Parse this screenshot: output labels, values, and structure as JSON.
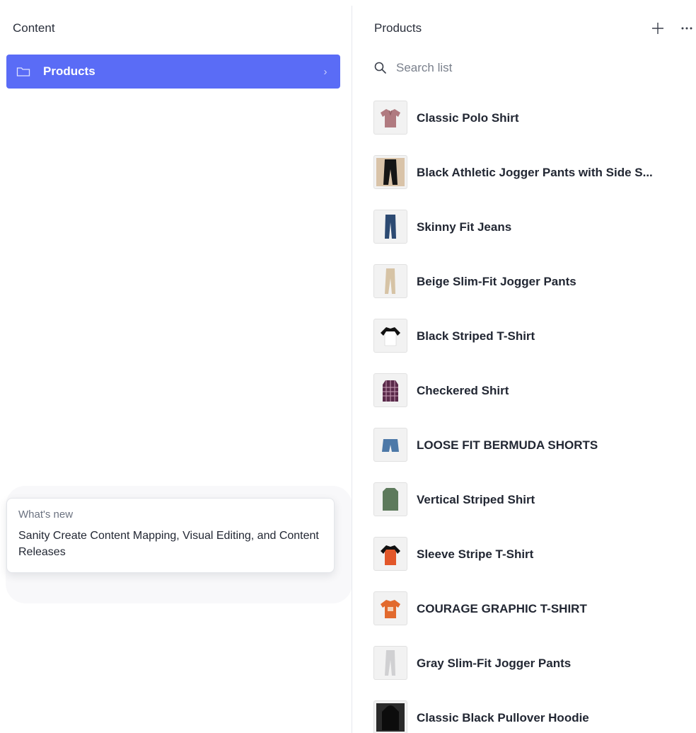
{
  "left": {
    "header": "Content",
    "nav_item": {
      "label": "Products",
      "chevron": "›"
    }
  },
  "whats_new": {
    "kicker": "What's new",
    "title": "Sanity Create Content Mapping, Visual Editing, and Content Releases"
  },
  "right": {
    "title": "Products",
    "search_placeholder": "Search list",
    "items": [
      {
        "name": "Classic Polo Shirt",
        "thumb": "polo-shirt-icon"
      },
      {
        "name": "Black Athletic Jogger Pants with Side S...",
        "thumb": "black-joggers-icon"
      },
      {
        "name": "Skinny Fit Jeans",
        "thumb": "jeans-icon"
      },
      {
        "name": "Beige Slim-Fit Jogger Pants",
        "thumb": "beige-pants-icon"
      },
      {
        "name": "Black Striped T-Shirt",
        "thumb": "raglan-tshirt-icon"
      },
      {
        "name": "Checkered Shirt",
        "thumb": "checkered-shirt-icon"
      },
      {
        "name": "LOOSE FIT BERMUDA SHORTS",
        "thumb": "shorts-icon"
      },
      {
        "name": "Vertical Striped Shirt",
        "thumb": "green-shirt-icon"
      },
      {
        "name": "Sleeve Stripe T-Shirt",
        "thumb": "orange-tshirt-icon"
      },
      {
        "name": "COURAGE GRAPHIC T-SHIRT",
        "thumb": "graphic-tshirt-icon"
      },
      {
        "name": "Gray Slim-Fit Jogger Pants",
        "thumb": "gray-pants-icon"
      },
      {
        "name": "Classic Black Pullover Hoodie",
        "thumb": "hoodie-icon"
      }
    ]
  },
  "colors": {
    "accent": "#5a6cf6",
    "text": "#222733",
    "muted": "#6b7280"
  }
}
